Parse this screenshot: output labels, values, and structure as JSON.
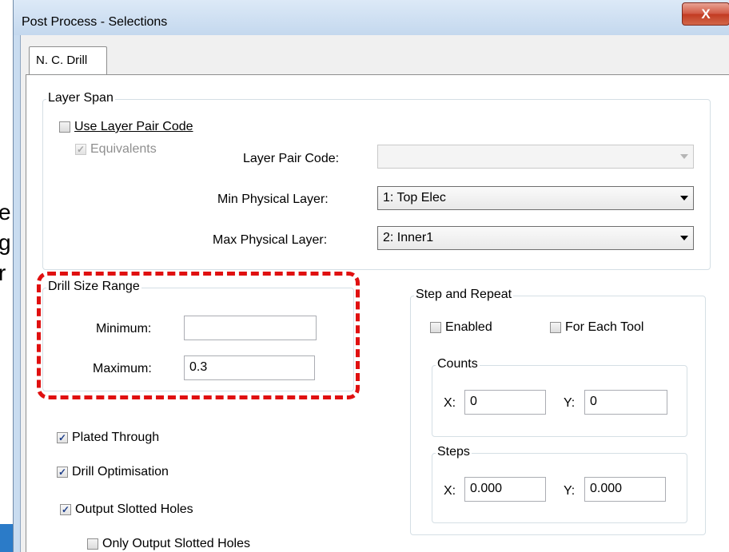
{
  "background": {
    "fragments": [
      "e",
      "g",
      "r"
    ]
  },
  "window": {
    "title": "Post Process - Selections",
    "close_glyph": "X"
  },
  "tabs": [
    {
      "label": "N. C. Drill",
      "active": true
    }
  ],
  "layer_span": {
    "label": "Layer Span",
    "use_layer_pair_code": {
      "label": "Use Layer Pair Code",
      "checked": false
    },
    "equivalents": {
      "label": "Equivalents",
      "checked": true,
      "disabled": true
    },
    "layer_pair_code": {
      "label": "Layer Pair Code:",
      "value": "",
      "disabled": true
    },
    "min_physical_layer": {
      "label": "Min Physical Layer:",
      "value": "1: Top Elec"
    },
    "max_physical_layer": {
      "label": "Max Physical Layer:",
      "value": "2: Inner1"
    }
  },
  "drill_size_range": {
    "label": "Drill Size Range",
    "minimum": {
      "label": "Minimum:",
      "value": ""
    },
    "maximum": {
      "label": "Maximum:",
      "value": "0.3"
    }
  },
  "options": {
    "plated_through": {
      "label": "Plated Through",
      "checked": true
    },
    "drill_optimisation": {
      "label": "Drill Optimisation",
      "checked": true
    },
    "output_slotted_holes": {
      "label": "Output Slotted Holes",
      "checked": true
    },
    "only_output_slotted_holes": {
      "label": "Only Output Slotted Holes",
      "checked": false
    }
  },
  "step_and_repeat": {
    "label": "Step and Repeat",
    "enabled": {
      "label": "Enabled",
      "checked": false
    },
    "for_each_tool": {
      "label": "For Each Tool",
      "checked": false
    },
    "counts": {
      "label": "Counts",
      "x_label": "X:",
      "x_value": "0",
      "y_label": "Y:",
      "y_value": "0"
    },
    "steps": {
      "label": "Steps",
      "x_label": "X:",
      "x_value": "0.000",
      "y_label": "Y:",
      "y_value": "0.000"
    }
  },
  "colors": {
    "highlight_dashes": "#e01010",
    "close_button": "#c23b22",
    "check_mark": "#1f3f8a"
  },
  "icons": {
    "check": "✓",
    "dropdown": "chevron-down-icon"
  }
}
